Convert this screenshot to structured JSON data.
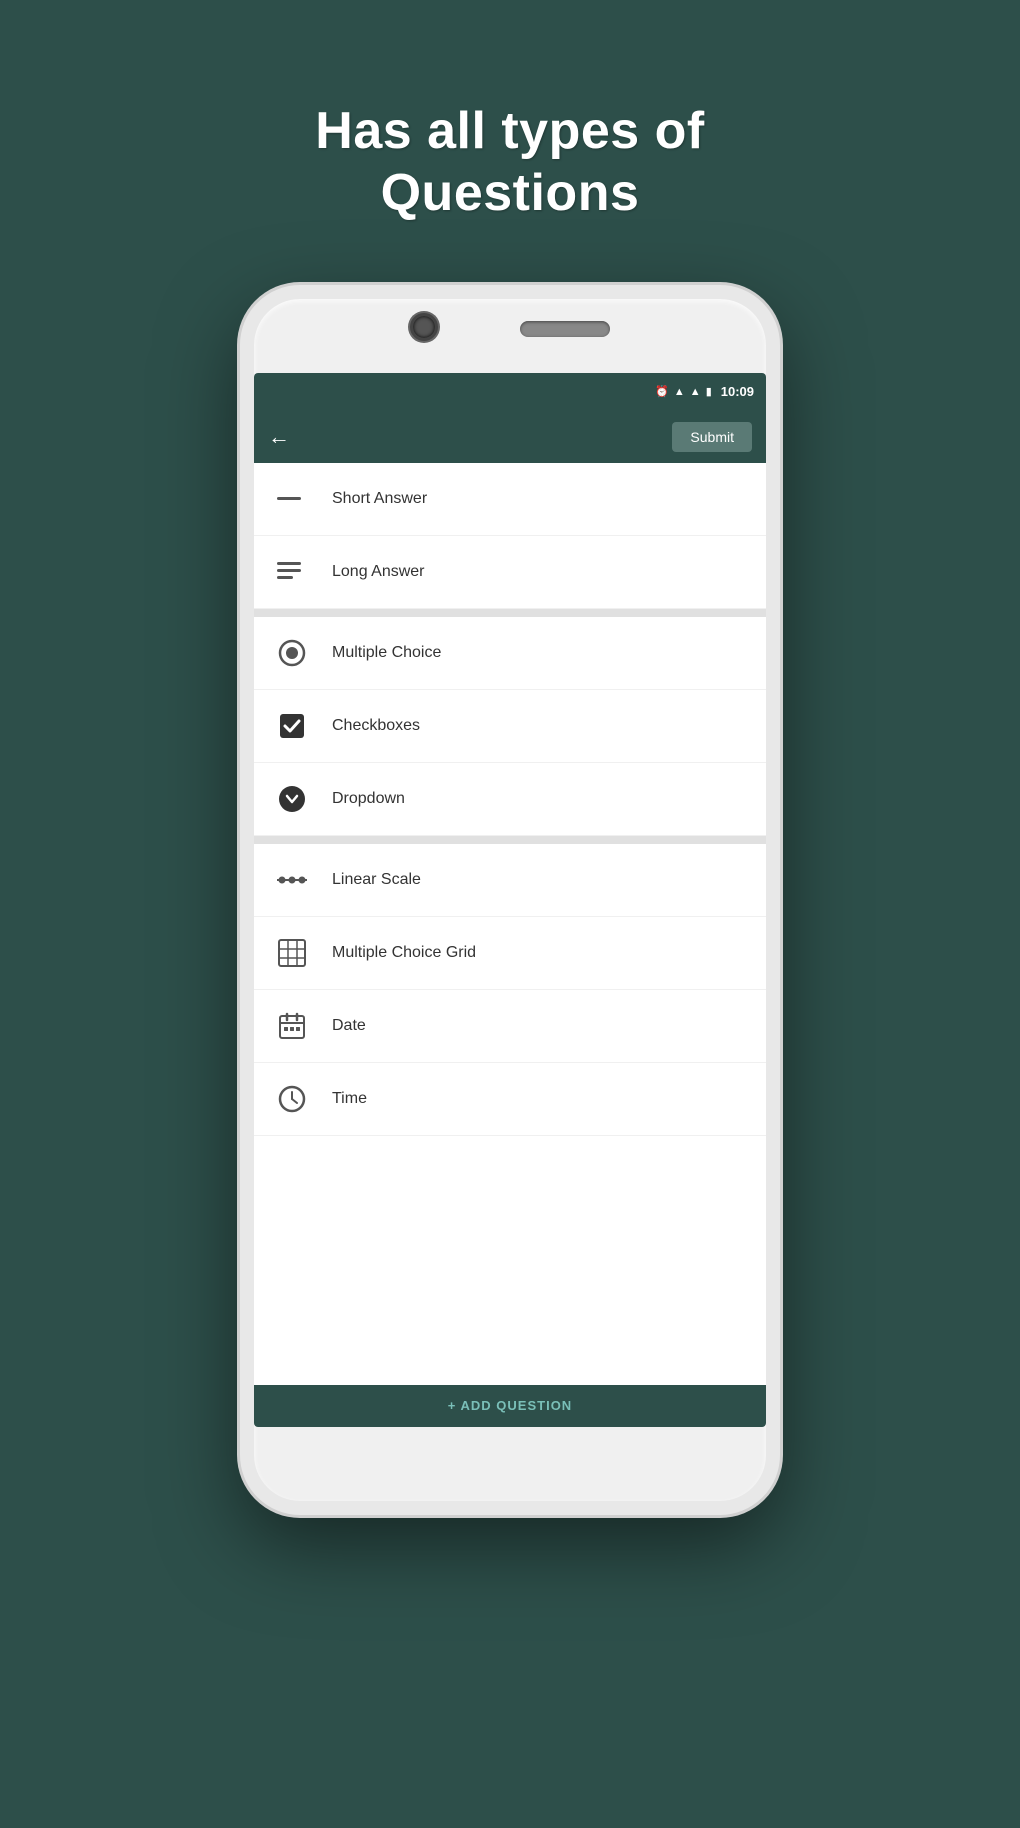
{
  "page": {
    "background_color": "#2d4f4a",
    "headline_line1": "Has all types of",
    "headline_line2": "Questions"
  },
  "status_bar": {
    "time": "10:09",
    "icons": [
      "alarm",
      "signal",
      "signal2",
      "battery"
    ]
  },
  "app_bar": {
    "back_label": "←",
    "submit_label": "Submit"
  },
  "menu": {
    "sections": [
      {
        "items": [
          {
            "id": "short-answer",
            "label": "Short Answer",
            "icon": "short-text"
          },
          {
            "id": "long-answer",
            "label": "Long Answer",
            "icon": "long-text"
          }
        ]
      },
      {
        "items": [
          {
            "id": "multiple-choice",
            "label": "Multiple Choice",
            "icon": "radio"
          },
          {
            "id": "checkboxes",
            "label": "Checkboxes",
            "icon": "checkbox"
          },
          {
            "id": "dropdown",
            "label": "Dropdown",
            "icon": "dropdown"
          }
        ]
      },
      {
        "items": [
          {
            "id": "linear-scale",
            "label": "Linear Scale",
            "icon": "scale"
          },
          {
            "id": "multiple-choice-grid",
            "label": "Multiple Choice Grid",
            "icon": "grid"
          },
          {
            "id": "date",
            "label": "Date",
            "icon": "calendar"
          },
          {
            "id": "time",
            "label": "Time",
            "icon": "clock"
          }
        ]
      }
    ],
    "add_question_label": "+ ADD QUESTION"
  }
}
